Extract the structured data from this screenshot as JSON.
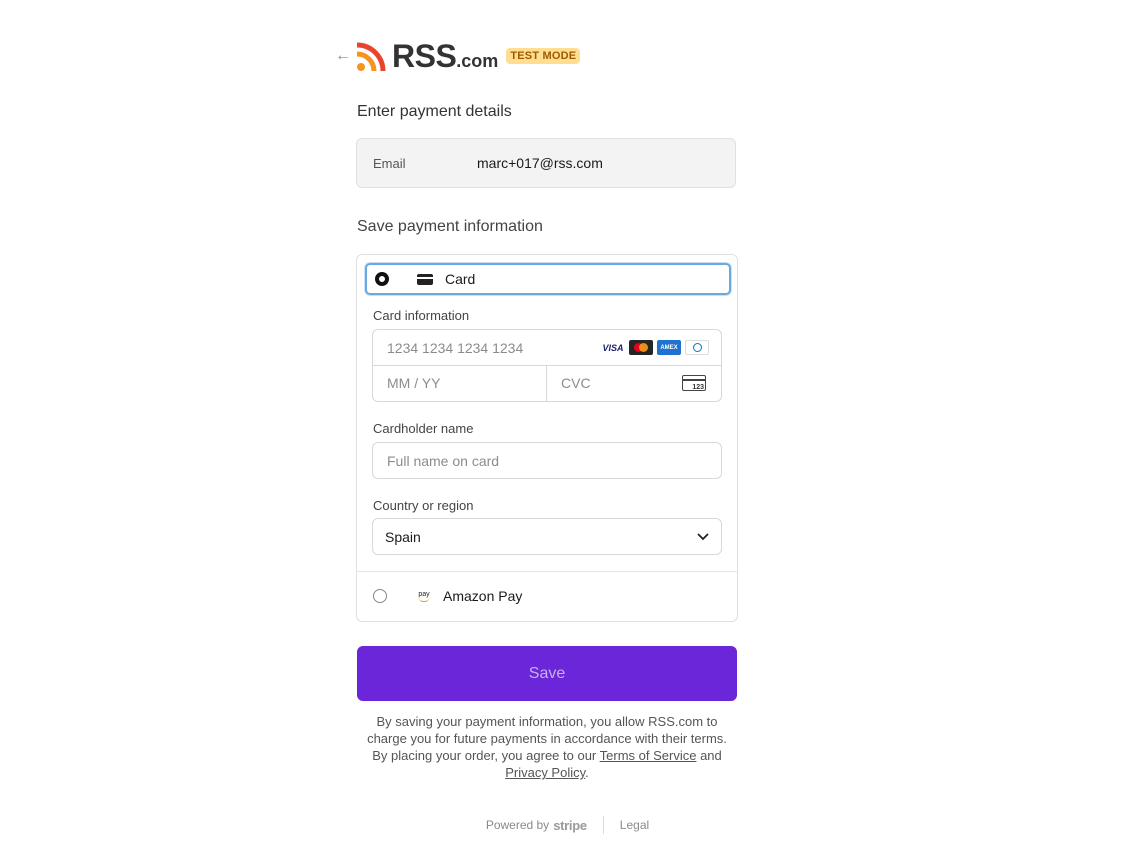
{
  "header": {
    "back_icon": "arrow-left-icon",
    "logo_main": "RSS",
    "logo_suffix": ".com",
    "badge": "TEST MODE",
    "logo_colors": {
      "feed_orange": "#f7941d",
      "feed_red": "#e8452c",
      "text": "#333333"
    }
  },
  "payment_details": {
    "title": "Enter payment details",
    "email_label": "Email",
    "email_value": "marc+017@rss.com"
  },
  "save_payment": {
    "title": "Save payment information",
    "methods": {
      "card": {
        "label": "Card",
        "selected": true,
        "icon": "credit-card-icon"
      },
      "amazon": {
        "label": "Amazon Pay",
        "selected": false,
        "icon": "amazon-pay-icon",
        "icon_text": "pay"
      }
    },
    "card_information_label": "Card information",
    "card_number_placeholder": "1234 1234 1234 1234",
    "brands": {
      "visa": "VISA",
      "amex": "AMEX"
    },
    "expiry_placeholder": "MM / YY",
    "cvc_placeholder": "CVC",
    "cvc_icon_text": "123",
    "cardholder_label": "Cardholder name",
    "cardholder_placeholder": "Full name on card",
    "country_label": "Country or region",
    "country_value": "Spain"
  },
  "actions": {
    "save_label": "Save",
    "accent_color": "#6c26d9"
  },
  "legal": {
    "line1": "By saving your payment information, you allow RSS.com to charge you for future payments in accordance with their terms.",
    "line2_prefix": "By placing your order, you agree to our ",
    "terms_link": "Terms of Service",
    "and": " and ",
    "privacy_link": "Privacy Policy",
    "period": "."
  },
  "footer": {
    "powered_by": "Powered by",
    "stripe": "stripe",
    "legal": "Legal"
  }
}
